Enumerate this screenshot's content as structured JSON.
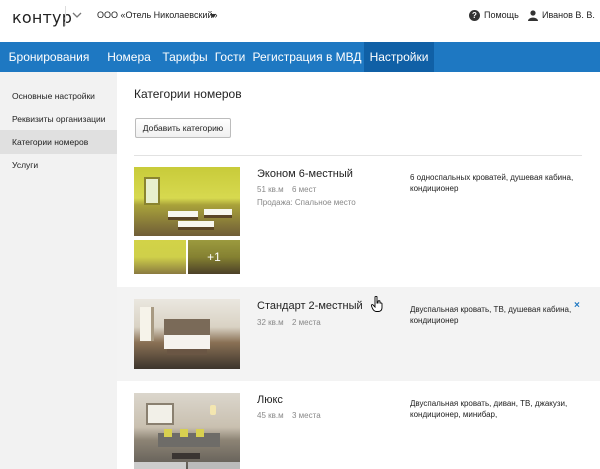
{
  "header": {
    "logo_text": "контур",
    "organization": "ООО «Отель Николаевский»",
    "help_label": "Помощь",
    "user_name": "Иванов В. В."
  },
  "nav": {
    "items": [
      {
        "label": "Бронирования"
      },
      {
        "label": "Номера"
      },
      {
        "label": "Тарифы"
      },
      {
        "label": "Гости"
      },
      {
        "label": "Регистрация в МВД"
      },
      {
        "label": "Настройки",
        "active": true
      }
    ]
  },
  "sidebar": {
    "items": [
      {
        "label": "Основные настройки"
      },
      {
        "label": "Реквизиты организации"
      },
      {
        "label": "Категории номеров",
        "active": true
      },
      {
        "label": "Услуги"
      }
    ]
  },
  "main": {
    "title": "Категории номеров",
    "add_button_label": "Добавить категорию",
    "categories": [
      {
        "name": "Эконом 6-местный",
        "area": "51 кв.м",
        "capacity": "6 мест",
        "sale_note": "Продажа: Спальное место",
        "description": "6 односпальных кроватей, душевая кабина, кондиционер",
        "extra_photos": "+1"
      },
      {
        "name": "Стандарт 2-местный",
        "area": "32 кв.м",
        "capacity": "2 места",
        "description": "Двуспальная кровать, ТВ, душевая кабина, кондиционер",
        "delete_label": "×"
      },
      {
        "name": "Люкс",
        "area": "45 кв.м",
        "capacity": "3 места",
        "description": "Двуспальная кровать, диван, ТВ, джакузи, кондиционер, минибар,"
      }
    ]
  },
  "colors": {
    "nav_bg": "#1e78c2",
    "nav_active_bg": "#1060a6",
    "sidebar_bg": "#f2f2f2",
    "accent": "#1e78c2"
  }
}
